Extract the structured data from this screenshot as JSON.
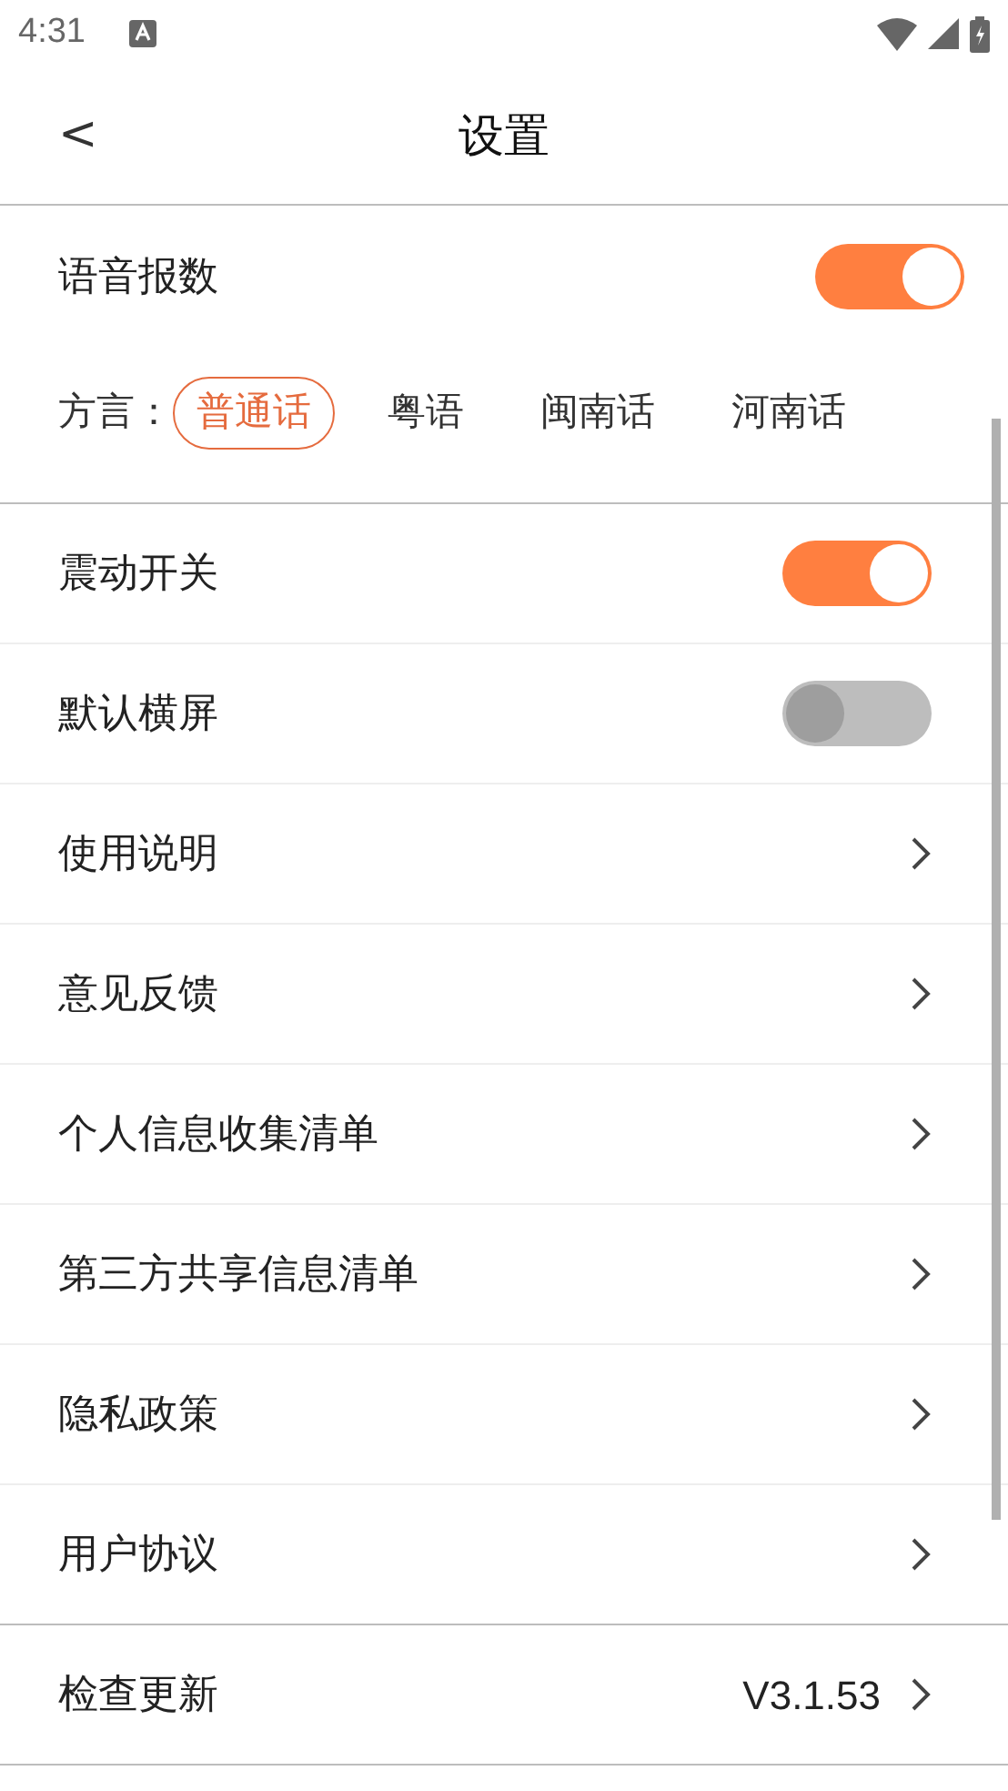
{
  "status_bar": {
    "time": "4:31"
  },
  "header": {
    "back": "<",
    "title": "设置"
  },
  "voice": {
    "label": "语音报数",
    "on": true,
    "dialect_label": "方言：",
    "dialects": [
      {
        "label": "普通话",
        "selected": true
      },
      {
        "label": "粤语",
        "selected": false
      },
      {
        "label": "闽南话",
        "selected": false
      },
      {
        "label": "河南话",
        "selected": false
      }
    ]
  },
  "rows": [
    {
      "kind": "toggle",
      "label": "震动开关",
      "on": true
    },
    {
      "kind": "toggle",
      "label": "默认横屏",
      "on": false
    },
    {
      "kind": "link",
      "label": "使用说明"
    },
    {
      "kind": "link",
      "label": "意见反馈"
    },
    {
      "kind": "link",
      "label": "个人信息收集清单"
    },
    {
      "kind": "link",
      "label": "第三方共享信息清单"
    },
    {
      "kind": "link",
      "label": "隐私政策"
    },
    {
      "kind": "link",
      "label": "用户协议"
    },
    {
      "kind": "value",
      "label": "检查更新",
      "value": "V3.1.53"
    }
  ]
}
